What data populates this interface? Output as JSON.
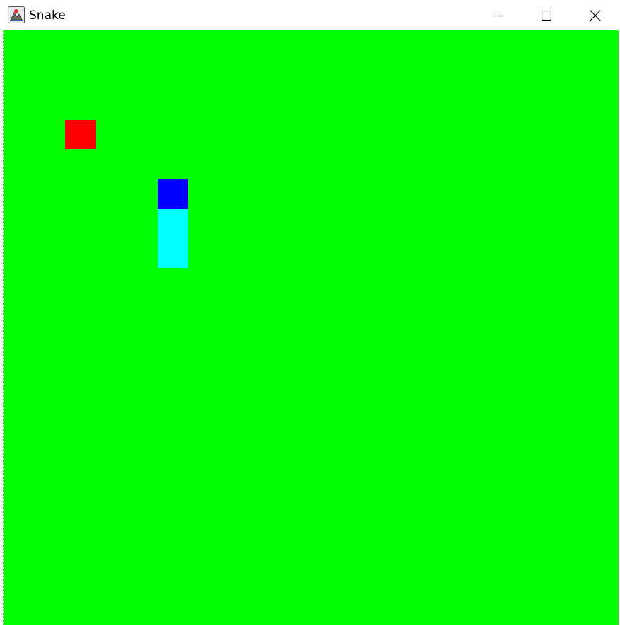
{
  "window": {
    "title": "Snake",
    "icon": "java-app-icon",
    "controls": [
      "minimize-icon",
      "maximize-icon",
      "close-icon"
    ]
  },
  "colors": {
    "board": "#00ff00",
    "food": "#ff0000",
    "snake_head": "#0000ff",
    "snake_body": "#00ffff"
  },
  "game": {
    "food": {
      "col": 2,
      "row": 3
    },
    "snake": [
      {
        "col": 5,
        "row": 5,
        "part": "head"
      },
      {
        "col": 5,
        "row": 6,
        "part": "body"
      },
      {
        "col": 5,
        "row": 7,
        "part": "body"
      }
    ]
  }
}
